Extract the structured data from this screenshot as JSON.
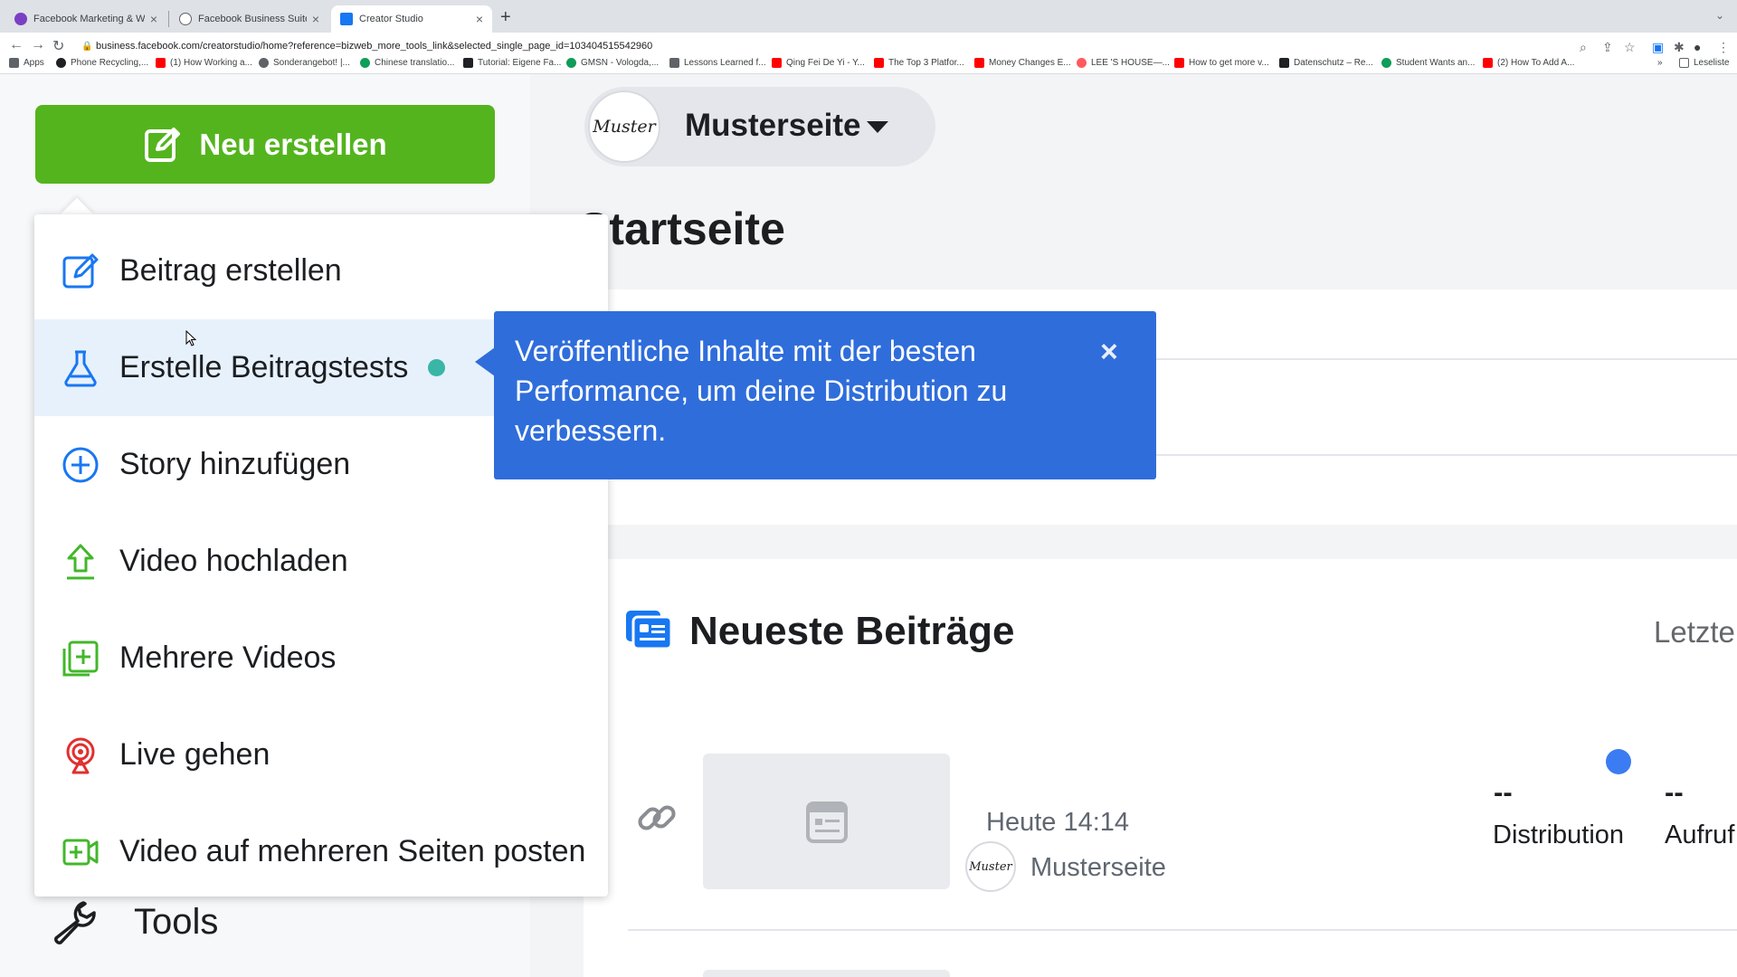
{
  "browser": {
    "tabs": [
      {
        "title": "Facebook Marketing & Werbea...",
        "favicon_color": "#7b3fc4"
      },
      {
        "title": "Facebook Business Suite",
        "favicon_color": "#5f6368"
      },
      {
        "title": "Creator Studio",
        "favicon_color": "#1877f2"
      }
    ],
    "new_tab": "+",
    "url": "business.facebook.com/creatorstudio/home?reference=bizweb_more_tools_link&selected_single_page_id=103404515542960",
    "bookmarks": [
      {
        "label": "Apps",
        "color": "#5f6368"
      },
      {
        "label": "Phone Recycling,...",
        "color": "#202124"
      },
      {
        "label": "(1) How Working a...",
        "color": "#ff0000"
      },
      {
        "label": "Sonderangebot! |...",
        "color": "#5f6368"
      },
      {
        "label": "Chinese translatio...",
        "color": "#0f9d58"
      },
      {
        "label": "Tutorial: Eigene Fa...",
        "color": "#202124"
      },
      {
        "label": "GMSN - Vologda,...",
        "color": "#0f9d58"
      },
      {
        "label": "Lessons Learned f...",
        "color": "#5f6368"
      },
      {
        "label": "Qing Fei De Yi - Y...",
        "color": "#ff0000"
      },
      {
        "label": "The Top 3 Platfor...",
        "color": "#ff0000"
      },
      {
        "label": "Money Changes E...",
        "color": "#ff0000"
      },
      {
        "label": "LEE 'S HOUSE—...",
        "color": "#ff5a5f"
      },
      {
        "label": "How to get more v...",
        "color": "#ff0000"
      },
      {
        "label": "Datenschutz – Re...",
        "color": "#202124"
      },
      {
        "label": "Student Wants an...",
        "color": "#0f9d58"
      },
      {
        "label": "(2) How To Add A...",
        "color": "#ff0000"
      }
    ],
    "bookmarks_more": "»",
    "reading_list": "Leseliste"
  },
  "app": {
    "create_button": "Neu erstellen",
    "page_selector": {
      "name": "Musterseite",
      "avatar_text": "Muster"
    },
    "home_title": "Startseite",
    "recent_posts": {
      "title": "Neueste Beiträge",
      "right_label": "Letzte",
      "post": {
        "time": "Heute 14:14",
        "page": "Musterseite",
        "avatar_text": "Muster",
        "metrics": [
          {
            "value": "--",
            "label": "Distribution"
          },
          {
            "value": "--",
            "label": "Aufruf"
          }
        ]
      }
    },
    "tools_label": "Tools"
  },
  "menu": {
    "items": [
      {
        "label": "Beitrag erstellen",
        "icon": "compose-icon"
      },
      {
        "label": "Erstelle Beitragstests",
        "icon": "flask-icon"
      },
      {
        "label": "Story hinzufügen",
        "icon": "plus-circle-icon"
      },
      {
        "label": "Video hochladen",
        "icon": "upload-icon"
      },
      {
        "label": "Mehrere Videos",
        "icon": "multi-video-icon"
      },
      {
        "label": "Live gehen",
        "icon": "live-icon"
      },
      {
        "label": "Video auf mehreren Seiten posten",
        "icon": "crosspost-video-icon"
      }
    ]
  },
  "tooltip": {
    "text": "Veröffentliche Inhalte mit der besten Performance, um deine Distribution zu verbessern.",
    "close": "×"
  },
  "colors": {
    "create_green": "#54b41e",
    "tooltip_blue": "#2f6ddb",
    "highlight": "#e7f1fc",
    "new_dot": "#39b6a6"
  }
}
